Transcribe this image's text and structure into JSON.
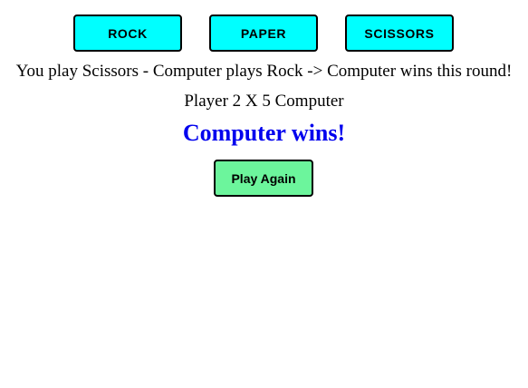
{
  "controls": {
    "rock_label": "ROCK",
    "paper_label": "PAPER",
    "scissors_label": "SCISSORS",
    "choice_button_color": "#00ffff"
  },
  "result": {
    "round_message": "You play Scissors - Computer plays Rock -> Computer wins this round!",
    "score_line": "Player 2 X 5 Computer",
    "winner_message": "Computer wins!",
    "winner_color": "#0000ee"
  },
  "actions": {
    "play_again_label": "Play Again",
    "play_again_color": "#6cf59c"
  }
}
